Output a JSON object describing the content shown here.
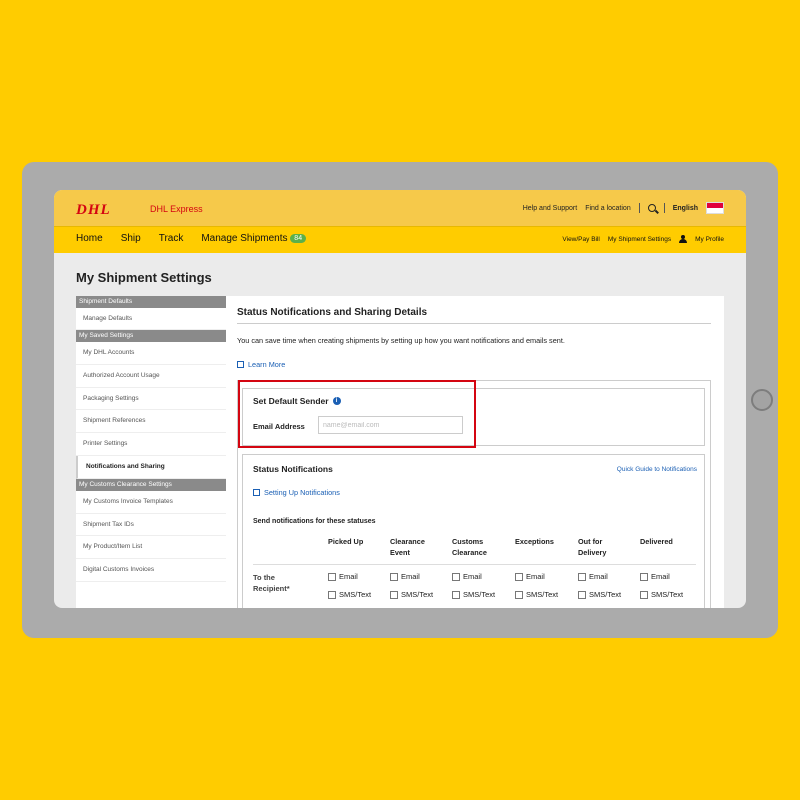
{
  "header": {
    "logo": "DHL",
    "brand": "DHL Express",
    "top_links": [
      "Help and Support",
      "Find a location"
    ],
    "language": "English"
  },
  "nav": {
    "items": [
      "Home",
      "Ship",
      "Track",
      "Manage Shipments"
    ],
    "badge": "84",
    "right_links": [
      "View/Pay Bill",
      "My Shipment Settings",
      "My Profile"
    ]
  },
  "page": {
    "title": "My Shipment Settings"
  },
  "sidebar": {
    "sections": [
      {
        "heading": "Shipment Defaults",
        "items": [
          "Manage Defaults"
        ]
      },
      {
        "heading": "My Saved Settings",
        "items": [
          "My DHL Accounts",
          "Authorized Account Usage",
          "Packaging Settings",
          "Shipment References",
          "Printer Settings",
          "Notifications and Sharing"
        ]
      },
      {
        "heading": "My Customs Clearance Settings",
        "items": [
          "My Customs Invoice Templates",
          "Shipment Tax IDs",
          "My Product/Item List",
          "Digital Customs Invoices"
        ]
      }
    ],
    "active": "Notifications and Sharing"
  },
  "main": {
    "title": "Status Notifications and Sharing Details",
    "intro": "You can save time when creating shipments by setting up how you want notifications and emails sent.",
    "learn_more": "Learn More",
    "sender": {
      "title": "Set Default Sender",
      "email_label": "Email Address",
      "email_placeholder": "name@email.com"
    },
    "notifications": {
      "title": "Status Notifications",
      "quick_guide": "Quick Guide to Notifications",
      "setup_link": "Setting Up Notifications",
      "send_label": "Send notifications for these statuses",
      "columns": [
        "Picked Up",
        "Clearance Event",
        "Customs Clearance",
        "Exceptions",
        "Out for Delivery",
        "Delivered"
      ],
      "row_label": "To the Recipient*",
      "options": [
        "Email",
        "SMS/Text"
      ]
    }
  },
  "colors": {
    "dhl_red": "#D40511",
    "dhl_yellow": "#FFCC00",
    "link_blue": "#1A5FB4"
  }
}
